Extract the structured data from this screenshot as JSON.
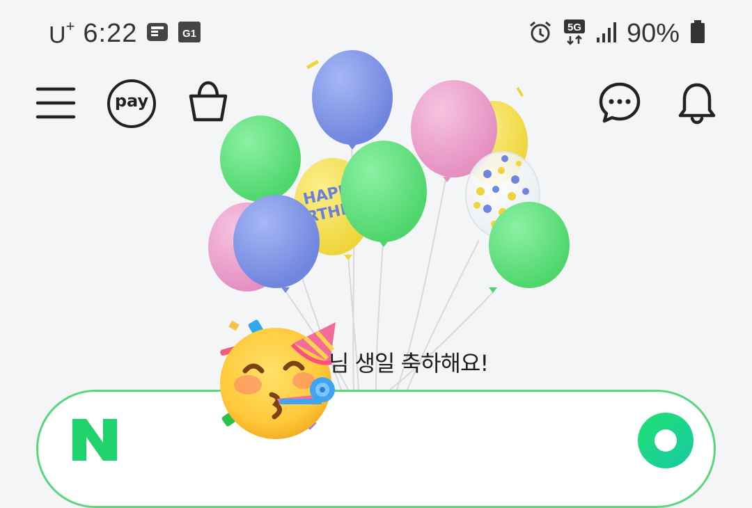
{
  "status_bar": {
    "carrier": "U",
    "carrier_sup": "+",
    "time": "6:22",
    "network": "5G",
    "battery": "90%"
  },
  "toolbar": {
    "pay_label": "pay"
  },
  "balloon_text": "HAPPY BIRTHDAY",
  "greeting": "님 생일 축하해요!",
  "search": {
    "logo_letter": "N"
  },
  "colors": {
    "naver_green": "#21d36d",
    "search_border": "#5ad67d",
    "balloon_blue": "#7f95e6",
    "balloon_green": "#5fe07c",
    "balloon_pink": "#eea4cf",
    "balloon_yellow": "#f4e152"
  }
}
